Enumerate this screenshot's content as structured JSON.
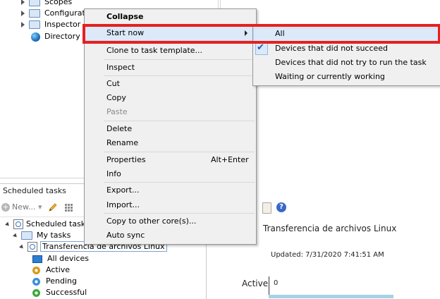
{
  "top_tree": {
    "items": [
      {
        "label": "Scopes"
      },
      {
        "label": "Configurat"
      },
      {
        "label": "Inspector"
      },
      {
        "label": "Directory"
      }
    ]
  },
  "scheduled_panel": {
    "header": "Scheduled tasks",
    "toolbar_new": "New...",
    "tree": {
      "root": "Scheduled tasks",
      "my_tasks": "My tasks",
      "task": "Transferencia de archivos Linux",
      "children": [
        {
          "label": "All devices"
        },
        {
          "label": "Active"
        },
        {
          "label": "Pending"
        },
        {
          "label": "Successful"
        }
      ]
    }
  },
  "detail": {
    "title": "Transferencia de archivos Linux",
    "updated": "Updated: 7/31/2020 7:41:51 AM",
    "active_label": "Active",
    "tick_zero": "0"
  },
  "context_menu": {
    "collapse": "Collapse",
    "start_now": "Start now",
    "clone": "Clone to task template...",
    "inspect": "Inspect",
    "cut": "Cut",
    "copy": "Copy",
    "paste": "Paste",
    "delete": "Delete",
    "rename": "Rename",
    "properties": "Properties",
    "properties_shortcut": "Alt+Enter",
    "info": "Info",
    "export": "Export...",
    "import": "Import...",
    "copy_other_core": "Copy to other core(s)...",
    "auto_sync": "Auto sync"
  },
  "submenu": {
    "all": "All",
    "not_succeed": "Devices that did not succeed",
    "not_try": "Devices that did not try to run the task",
    "waiting": "Waiting or currently working"
  },
  "colors": {
    "highlight": "#dbe9f9",
    "annotation_red": "#e6201f",
    "bar": "#a4d2e6"
  }
}
